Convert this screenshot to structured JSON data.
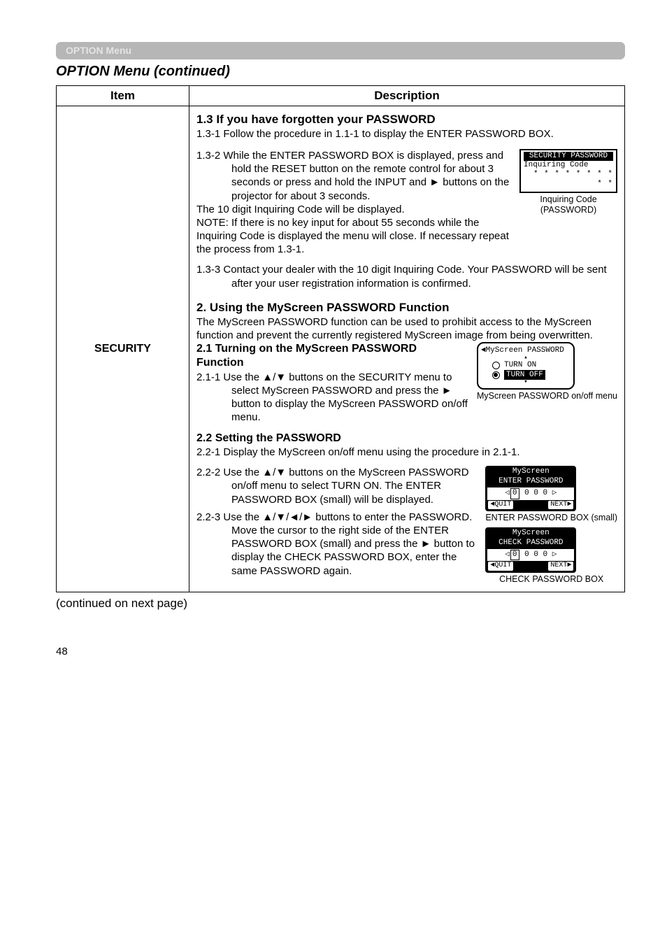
{
  "header": {
    "pill": "OPTION Menu",
    "title": "OPTION Menu (continued)"
  },
  "table": {
    "col_item": "Item",
    "col_desc": "Description",
    "item_label": "SECURITY"
  },
  "s13": {
    "heading": "1.3 If you have forgotten your PASSWORD",
    "p131": "1.3-1 Follow the procedure in 1.1-1 to display the ENTER PASSWORD BOX.",
    "p132": "1.3-2 While the ENTER PASSWORD BOX is displayed, press and hold the RESET button on the remote control for about 3 seconds or press and hold the INPUT and ► buttons on the projector for about 3 seconds.",
    "p132b": "The 10 digit Inquiring Code will be displayed.",
    "p132c": "NOTE: If there is no key input for about 55 seconds while the Inquiring Code is displayed the menu will close. If necessary repeat the process from 1.3-1.",
    "p133": "1.3-3 Contact your dealer with the 10 digit Inquiring Code. Your PASSWORD will be sent after your user registration information is confirmed."
  },
  "osd_inquiring": {
    "title": "SECURITY PASSWORD",
    "line1": "Inquiring Code",
    "line2": "* *  * * * *  * * * *",
    "caption": "Inquiring Code\n(PASSWORD)"
  },
  "s2": {
    "heading": "2. Using the MyScreen PASSWORD Function",
    "intro": "The MyScreen PASSWORD function can be used to prohibit access to the MyScreen function and prevent the currently registered MyScreen image from being overwritten.",
    "h21a": "2.1 Turning on the MyScreen PASSWORD",
    "h21b": "Function",
    "p211": "2.1-1 Use the ▲/▼ buttons on the SECURITY menu to select MyScreen PASSWORD and press the ► button to display the MyScreen PASSWORD on/off menu."
  },
  "osd_myscreen_menu": {
    "lead": "◄MyScreen PASSWORD",
    "opt_on": "TURN ON",
    "opt_off": "TURN OFF",
    "caption": "MyScreen PASSWORD on/off menu"
  },
  "s22": {
    "heading": "2.2 Setting the PASSWORD",
    "p221": "2.2-1 Display the MyScreen on/off menu using the procedure in 2.1-1.",
    "p222": "2.2-2 Use the ▲/▼ buttons on the MyScreen PASSWORD on/off menu to select TURN ON. The ENTER PASSWORD BOX (small) will be displayed.",
    "p223": "2.2-3 Use the ▲/▼/◄/► buttons to enter the PASSWORD. Move the cursor to the right side of the ENTER PASSWORD BOX (small) and press the ► button to display the CHECK PASSWORD BOX, enter the same PASSWORD again."
  },
  "osd_enter": {
    "l1": "MyScreen",
    "l2": "ENTER PASSWORD",
    "digits": "0  0  0 ▷",
    "quit": "◄QUIT",
    "next": "NEXT►",
    "caption": "ENTER PASSWORD BOX (small)"
  },
  "osd_check": {
    "l1": "MyScreen",
    "l2": "CHECK PASSWORD",
    "digits": "0  0  0 ▷",
    "quit": "◄QUIT",
    "next": "NEXT►",
    "caption": "CHECK PASSWORD BOX"
  },
  "footer": {
    "cont": "(continued on next page)",
    "page": "48"
  }
}
